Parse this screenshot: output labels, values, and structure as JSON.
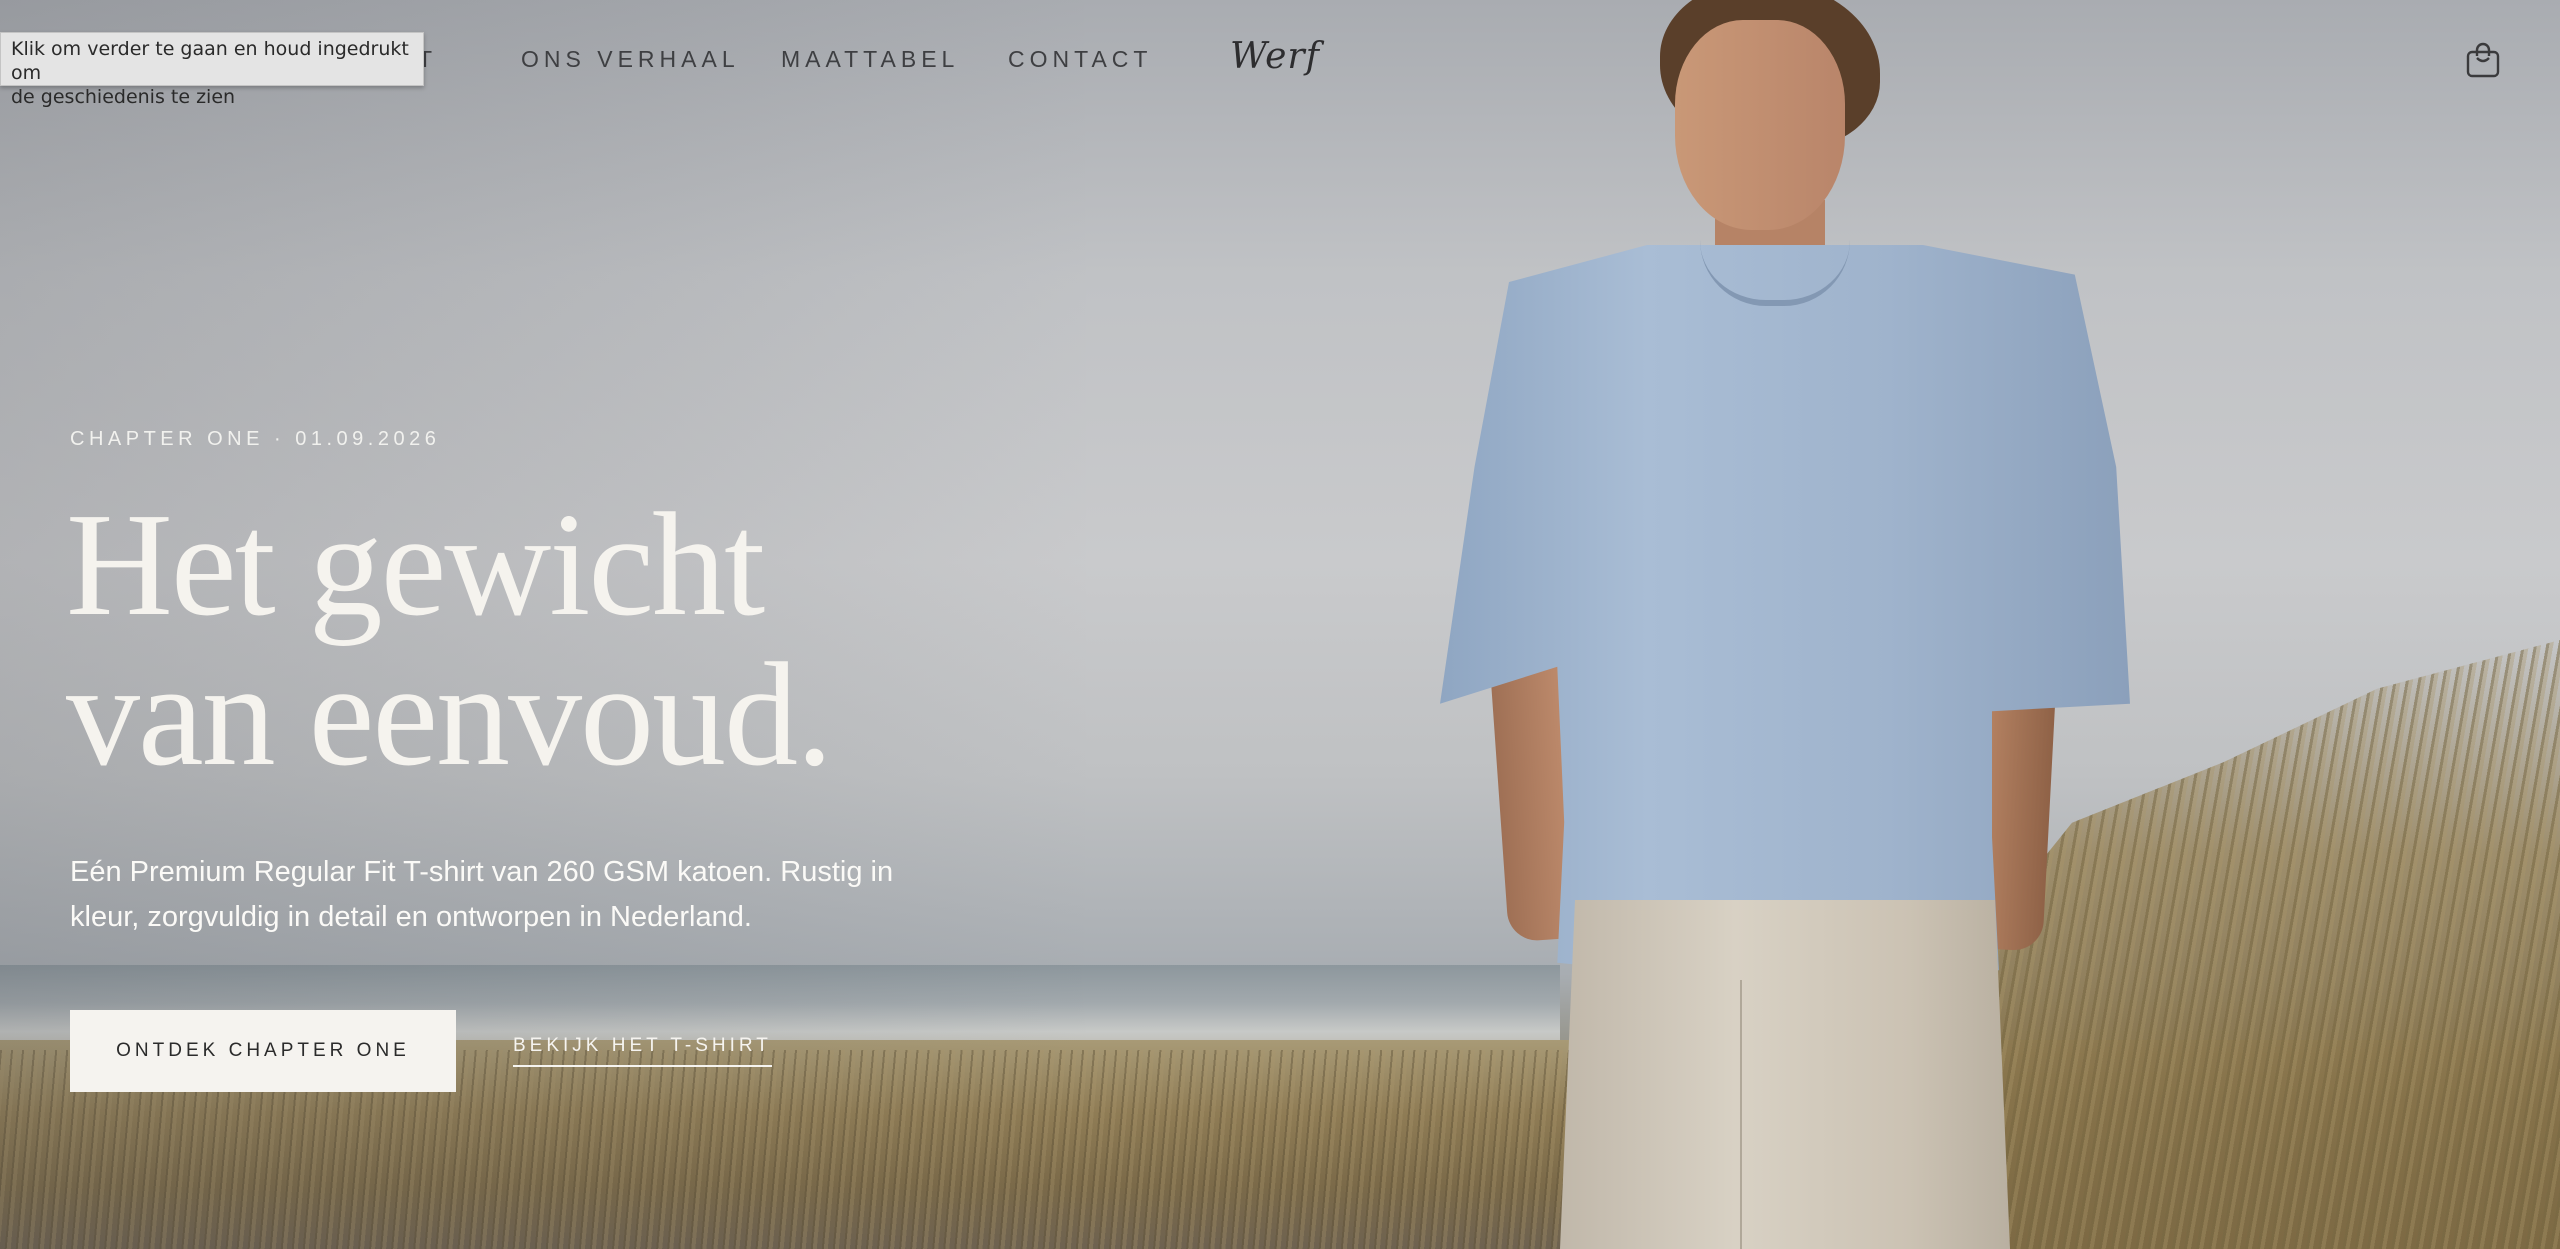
{
  "tooltip": {
    "line1": "Klik om verder te gaan en houd ingedrukt om",
    "line2": "de geschiedenis te zien"
  },
  "nav": {
    "items": [
      {
        "label": "T"
      },
      {
        "label": "ONS VERHAAL"
      },
      {
        "label": "MAATTABEL"
      },
      {
        "label": "CONTACT"
      }
    ],
    "logo": "Werf",
    "cart_icon": "shopping-bag-icon"
  },
  "hero": {
    "kicker": "CHAPTER ONE · 01.09.2026",
    "headline_line1": "Het gewicht",
    "headline_line2": "van eenvoud.",
    "subtitle": "Eén Premium Regular Fit T-shirt van 260 GSM katoen. Rustig in kleur, zorgvuldig in detail en ontworpen in Nederland.",
    "cta_primary": "ONTDEK CHAPTER ONE",
    "cta_secondary": "BEKIJK HET T-SHIRT"
  },
  "colors": {
    "text_dark": "#3e3f42",
    "text_light": "#f5f3ee",
    "button_bg": "#f5f3ef",
    "shirt": "#a9bdd5"
  }
}
